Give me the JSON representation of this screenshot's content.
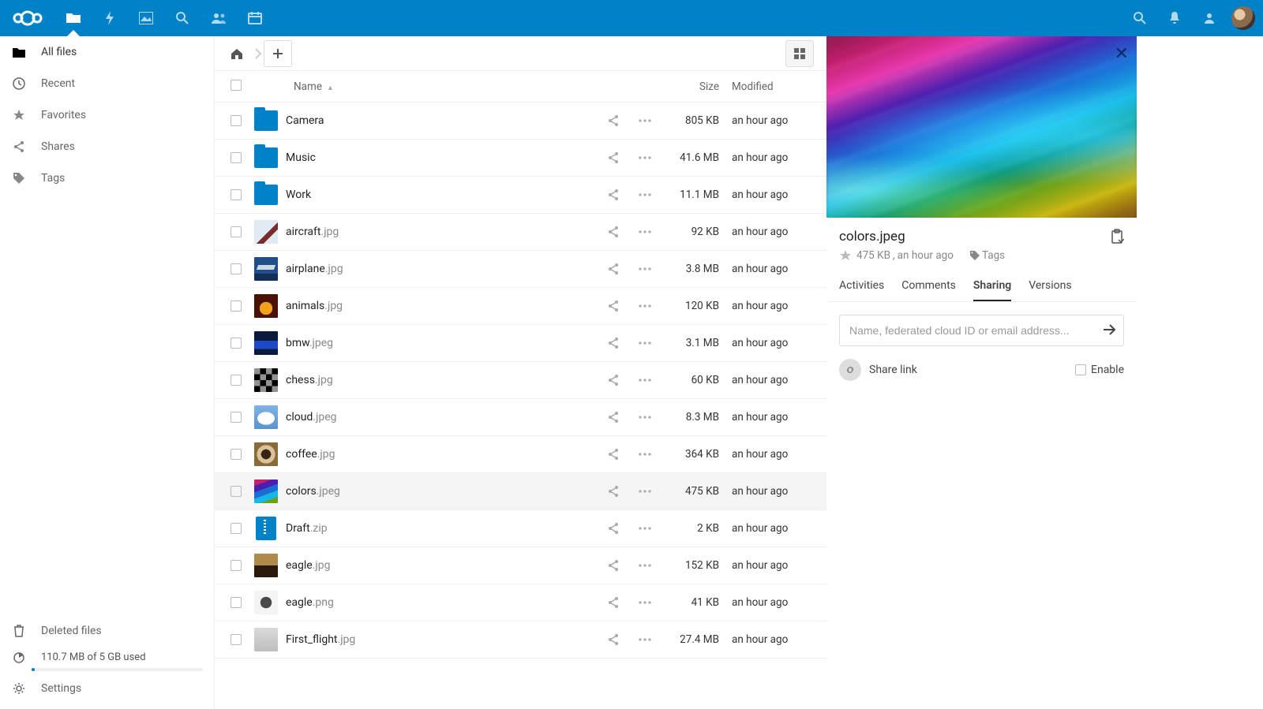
{
  "leftnav": {
    "items": [
      {
        "label": "All files"
      },
      {
        "label": "Recent"
      },
      {
        "label": "Favorites"
      },
      {
        "label": "Shares"
      },
      {
        "label": "Tags"
      }
    ],
    "deleted": "Deleted files",
    "quota": "110.7 MB of 5 GB used",
    "settings": "Settings"
  },
  "header": {
    "name_col": "Name",
    "size_col": "Size",
    "modified_col": "Modified"
  },
  "files": [
    {
      "name": "Camera",
      "ext": "",
      "type": "folder",
      "size": "805 KB",
      "modified": "an hour ago"
    },
    {
      "name": "Music",
      "ext": "",
      "type": "folder",
      "size": "41.6 MB",
      "modified": "an hour ago"
    },
    {
      "name": "Work",
      "ext": "",
      "type": "folder",
      "size": "11.1 MB",
      "modified": "an hour ago"
    },
    {
      "name": "aircraft",
      "ext": ".jpg",
      "type": "image",
      "thumb": "th-aircraft",
      "size": "92 KB",
      "modified": "an hour ago"
    },
    {
      "name": "airplane",
      "ext": ".jpg",
      "type": "image",
      "thumb": "th-airplane",
      "size": "3.8 MB",
      "modified": "an hour ago"
    },
    {
      "name": "animals",
      "ext": ".jpg",
      "type": "image",
      "thumb": "th-animals",
      "size": "120 KB",
      "modified": "an hour ago"
    },
    {
      "name": "bmw",
      "ext": ".jpeg",
      "type": "image",
      "thumb": "th-bmw",
      "size": "3.1 MB",
      "modified": "an hour ago"
    },
    {
      "name": "chess",
      "ext": ".jpg",
      "type": "image",
      "thumb": "th-chess",
      "size": "60 KB",
      "modified": "an hour ago"
    },
    {
      "name": "cloud",
      "ext": ".jpeg",
      "type": "image",
      "thumb": "th-cloud",
      "size": "8.3 MB",
      "modified": "an hour ago"
    },
    {
      "name": "coffee",
      "ext": ".jpg",
      "type": "image",
      "thumb": "th-coffee",
      "size": "364 KB",
      "modified": "an hour ago"
    },
    {
      "name": "colors",
      "ext": ".jpeg",
      "type": "image",
      "thumb": "th-colors",
      "size": "475 KB",
      "modified": "an hour ago",
      "selected": true
    },
    {
      "name": "Draft",
      "ext": ".zip",
      "type": "zip",
      "size": "2 KB",
      "modified": "an hour ago"
    },
    {
      "name": "eagle",
      "ext": ".jpg",
      "type": "image",
      "thumb": "th-eagle1",
      "size": "152 KB",
      "modified": "an hour ago"
    },
    {
      "name": "eagle",
      "ext": ".png",
      "type": "image",
      "thumb": "th-eagle2",
      "size": "41 KB",
      "modified": "an hour ago"
    },
    {
      "name": "First_flight",
      "ext": ".jpg",
      "type": "image",
      "thumb": "th-first",
      "size": "27.4 MB",
      "modified": "an hour ago"
    }
  ],
  "details": {
    "title": "colors.jpeg",
    "size": "475 KB",
    "sep": ", ",
    "modified": "an hour ago",
    "tags": "Tags",
    "tabs": [
      {
        "label": "Activities"
      },
      {
        "label": "Comments"
      },
      {
        "label": "Sharing",
        "active": true
      },
      {
        "label": "Versions"
      }
    ],
    "share_placeholder": "Name, federated cloud ID or email address...",
    "share_link": "Share link",
    "enable": "Enable"
  }
}
